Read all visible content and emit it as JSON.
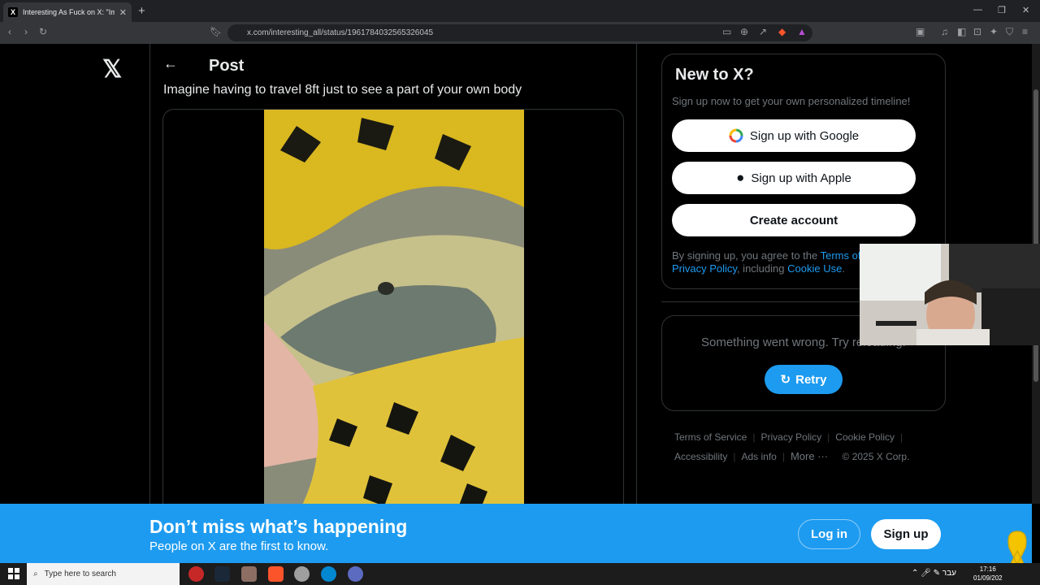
{
  "browser": {
    "tab_title": "Interesting As Fuck on X: \"Imag",
    "tab_favicon": "X",
    "url": "x.com/interesting_all/status/1961784032565326045"
  },
  "post": {
    "header": "Post",
    "text": "Imagine having to travel 8ft just to see a part of your own body"
  },
  "signup": {
    "title": "New to X?",
    "subtitle": "Sign up now to get your own personalized timeline!",
    "google_label": "Sign up with Google",
    "apple_label": "Sign up with Apple",
    "create_label": "Create account",
    "legal_prefix": "By signing up, you agree to the ",
    "terms_link": "Terms of",
    "privacy_link": "Privacy Policy",
    "legal_mid": ", including ",
    "cookie_link": "Cookie Use",
    "legal_end": "."
  },
  "error": {
    "message": "Something went wrong. Try reloading.",
    "retry_label": "Retry"
  },
  "footer": {
    "terms": "Terms of Service",
    "privacy": "Privacy Policy",
    "cookie": "Cookie Policy",
    "accessibility": "Accessibility",
    "ads": "Ads info",
    "more": "More ···",
    "copyright": "© 2025 X Corp."
  },
  "banner": {
    "title": "Don’t miss what’s happening",
    "subtitle": "People on X are the first to know.",
    "login_label": "Log in",
    "signup_label": "Sign up"
  },
  "taskbar": {
    "search_placeholder": "Type here to search",
    "time": "17:16",
    "date": "01/09/202",
    "lang": "עבר"
  },
  "colors": {
    "accent": "#1d9bf0",
    "background": "#000000",
    "muted": "#71767b"
  }
}
